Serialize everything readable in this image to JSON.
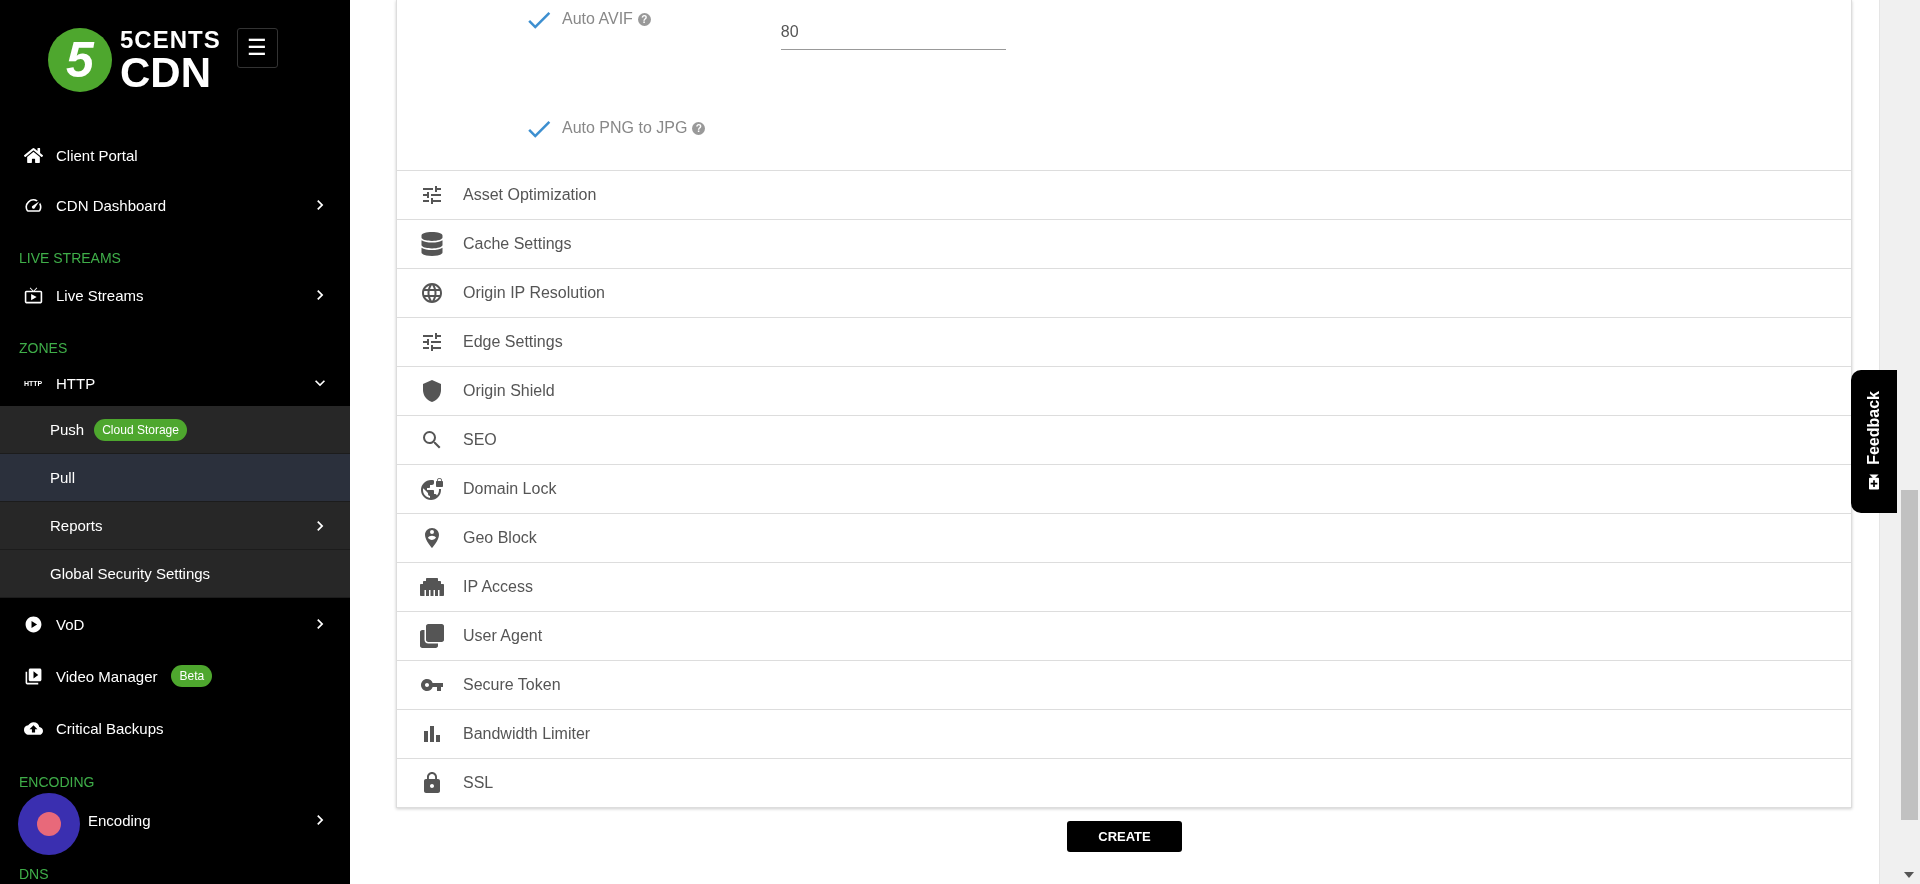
{
  "logo": {
    "mark": "5",
    "line1": "5CENTS",
    "line2": "CDN"
  },
  "menu_button": {
    "label": "☰"
  },
  "sidebar": [
    {
      "kind": "item",
      "label": "Client Portal"
    },
    {
      "kind": "item",
      "label": "CDN Dashboard",
      "expanded": false
    },
    {
      "kind": "section",
      "label": "LIVE STREAMS"
    },
    {
      "kind": "item",
      "label": "Live Streams",
      "expanded": false
    },
    {
      "kind": "section",
      "label": "ZONES"
    },
    {
      "kind": "item",
      "label": "HTTP",
      "icon_text": "HTTP",
      "expanded": true,
      "children": [
        {
          "label": "Push",
          "badge": "Cloud Storage",
          "selected": false
        },
        {
          "label": "Pull",
          "selected": true
        },
        {
          "label": "Reports",
          "selected": false,
          "expanded": false
        },
        {
          "label": "Global Security Settings",
          "selected": false
        }
      ]
    },
    {
      "kind": "item",
      "label": "VoD",
      "expanded": false
    },
    {
      "kind": "item",
      "label": "Video Manager",
      "badge": "Beta"
    },
    {
      "kind": "item",
      "label": "Critical Backups"
    },
    {
      "kind": "section",
      "label": "ENCODING"
    },
    {
      "kind": "item",
      "label": "Encoding",
      "expanded": false
    },
    {
      "kind": "section",
      "label": "DNS"
    }
  ],
  "options": [
    {
      "label": "Auto AVIF",
      "checked": true,
      "help": "?",
      "field_value": "80"
    },
    {
      "label": "Auto PNG to JPG",
      "checked": true,
      "help": "?"
    }
  ],
  "sections": [
    "Asset Optimization",
    "Cache Settings",
    "Origin IP Resolution",
    "Edge Settings",
    "Origin Shield",
    "SEO",
    "Domain Lock",
    "Geo Block",
    "IP Access",
    "User Agent",
    "Secure Token",
    "Bandwidth Limiter",
    "SSL"
  ],
  "create_button": "CREATE",
  "feedback_tab": "Feedback"
}
